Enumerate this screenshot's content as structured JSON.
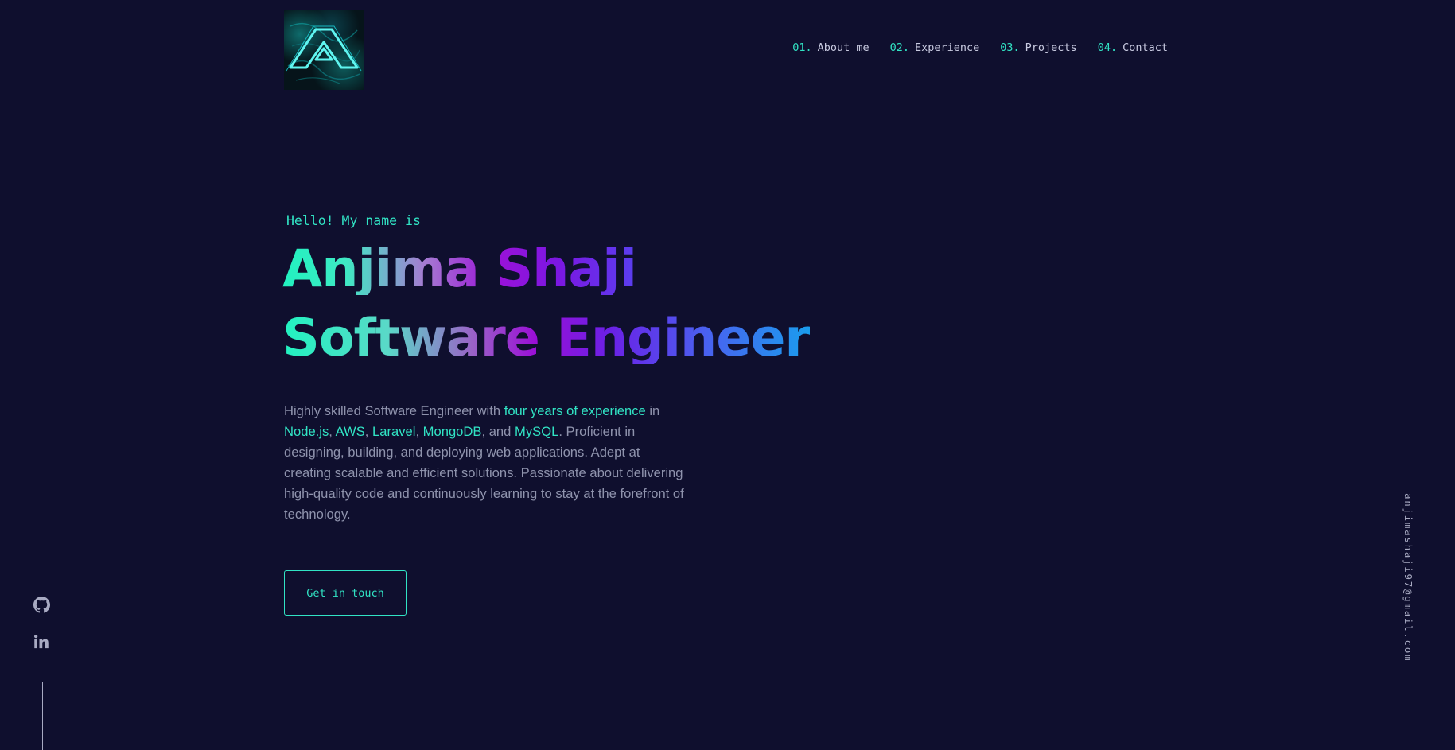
{
  "header": {
    "logo_icon": "stylized-a-logo-icon",
    "nav": [
      {
        "num": "01.",
        "label": "About me"
      },
      {
        "num": "02.",
        "label": "Experience"
      },
      {
        "num": "03.",
        "label": "Projects"
      },
      {
        "num": "04.",
        "label": "Contact"
      }
    ]
  },
  "hero": {
    "greeting": "Hello! My name is",
    "name": "Anjima Shaji",
    "role": "Software Engineer",
    "bio": {
      "p1": "Highly skilled Software Engineer with ",
      "h1": "four years of experience",
      "p2": " in ",
      "h2": "Node.js",
      "p3": ", ",
      "h3": "AWS",
      "p4": ", ",
      "h4": "Laravel",
      "p5": ", ",
      "h5": "MongoDB",
      "p6": ", and ",
      "h6": "MySQL",
      "p7": ". Proficient in designing, building, and deploying web applications. Adept at creating scalable and efficient solutions. Passionate about delivering high-quality code and continuously learning to stay at the forefront of technology."
    },
    "cta_label": "Get in touch"
  },
  "social": {
    "github_icon": "github-icon",
    "linkedin_icon": "linkedin-icon"
  },
  "email": "anjimashaji97@gmail.com",
  "colors": {
    "background": "#0f0f2e",
    "accent": "#31e3c4",
    "text": "#8f93ad",
    "nav_text": "#c8cae0"
  }
}
